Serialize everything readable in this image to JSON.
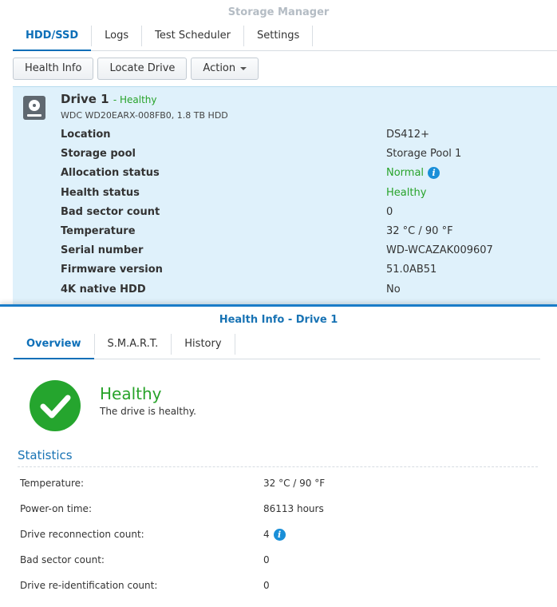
{
  "window": {
    "title": "Storage Manager"
  },
  "main_tabs": [
    {
      "label": "HDD/SSD",
      "active": true
    },
    {
      "label": "Logs",
      "active": false
    },
    {
      "label": "Test Scheduler",
      "active": false
    },
    {
      "label": "Settings",
      "active": false
    }
  ],
  "toolbar": {
    "health_info": "Health Info",
    "locate_drive": "Locate Drive",
    "action": "Action"
  },
  "drive": {
    "name": "Drive 1",
    "health_suffix": "- Healthy",
    "model": "WDC WD20EARX-008FB0, 1.8 TB HDD",
    "properties": [
      {
        "label": "Location",
        "value": "DS412+"
      },
      {
        "label": "Storage pool",
        "value": "Storage Pool 1"
      },
      {
        "label": "Allocation status",
        "value": "Normal"
      },
      {
        "label": "Health status",
        "value": "Healthy"
      },
      {
        "label": "Bad sector count",
        "value": "0"
      },
      {
        "label": "Temperature",
        "value": "32 °C / 90 °F"
      },
      {
        "label": "Serial number",
        "value": "WD-WCAZAK009607"
      },
      {
        "label": "Firmware version",
        "value": "51.0AB51"
      },
      {
        "label": "4K native HDD",
        "value": "No"
      }
    ]
  },
  "dialog": {
    "title": "Health Info - Drive 1",
    "tabs": [
      {
        "label": "Overview",
        "active": true
      },
      {
        "label": "S.M.A.R.T.",
        "active": false
      },
      {
        "label": "History",
        "active": false
      }
    ],
    "status_title": "Healthy",
    "status_desc": "The drive is healthy.",
    "section_title": "Statistics",
    "stats": [
      {
        "label": "Temperature:",
        "value": "32 °C / 90 °F"
      },
      {
        "label": "Power-on time:",
        "value": "86113 hours"
      },
      {
        "label": "Drive reconnection count:",
        "value": "4"
      },
      {
        "label": "Bad sector count:",
        "value": "0"
      },
      {
        "label": "Drive re-identification count:",
        "value": "0"
      }
    ]
  },
  "info_glyph": "i",
  "colors": {
    "accent": "#0d6fb8",
    "healthy": "#28a32a",
    "panel_bg": "#dff1fb",
    "info": "#1a8fd8"
  }
}
